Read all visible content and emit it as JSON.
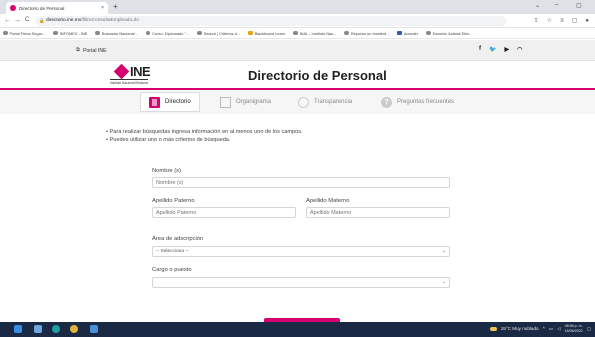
{
  "browser": {
    "tab_title": "Directorio de Personal",
    "tab_close": "×",
    "new_tab": "+",
    "window_controls": [
      "⌄",
      "–",
      "▢"
    ],
    "url_domain": "directorio.ine.mx",
    "url_path": "/filtroConsultaEmpleado.do",
    "nav": [
      "←",
      "→",
      "C"
    ]
  },
  "bookmarks": [
    "Portal Firma Segur...",
    "INFOMEX - INE",
    "Buscador Nacional...",
    "Curso: Diplomado \"...",
    "Search | Criterios d...",
    "Blackboard Learn",
    "INAI – Instituto Nac...",
    "Reportar un Incident...",
    "Acceder",
    "Escuela Judicial Elec..."
  ],
  "site": {
    "portal_link": "Portal INE",
    "logo_text": "INE",
    "logo_subtitle": "Instituto Nacional Electoral",
    "title": "Directorio de Personal"
  },
  "tabs": [
    {
      "label": "Directorio",
      "icon": "book-icon"
    },
    {
      "label": "Organigrama",
      "icon": "org-chart-icon"
    },
    {
      "label": "Transparencia",
      "icon": "transparency-icon"
    },
    {
      "label": "Preguntas frecuentes",
      "icon": "question-icon"
    }
  ],
  "instructions": [
    "Para realizar búsquedas ingresa información en al menos uno de los campos.",
    "Puedes utilizar uno o más criterios de búsqueda."
  ],
  "form": {
    "nombre_label": "Nombre (s)",
    "nombre_placeholder": "Nombre (s)",
    "paterno_label": "Apellido Paterno",
    "paterno_placeholder": "Apellido Paterno",
    "materno_label": "Apellido Materno",
    "materno_placeholder": "Apellido Materno",
    "area_label": "Área de adscripción",
    "area_value": "-- Selecciona --",
    "cargo_label": "Cargo o puesto",
    "cargo_value": ""
  },
  "taskbar": {
    "weather": "15°C  Muy nublado",
    "time": "08:56 p. m.",
    "date": "16/06/2022"
  },
  "colors": {
    "accent": "#d6006f",
    "taskbar": "#1b2a44"
  }
}
